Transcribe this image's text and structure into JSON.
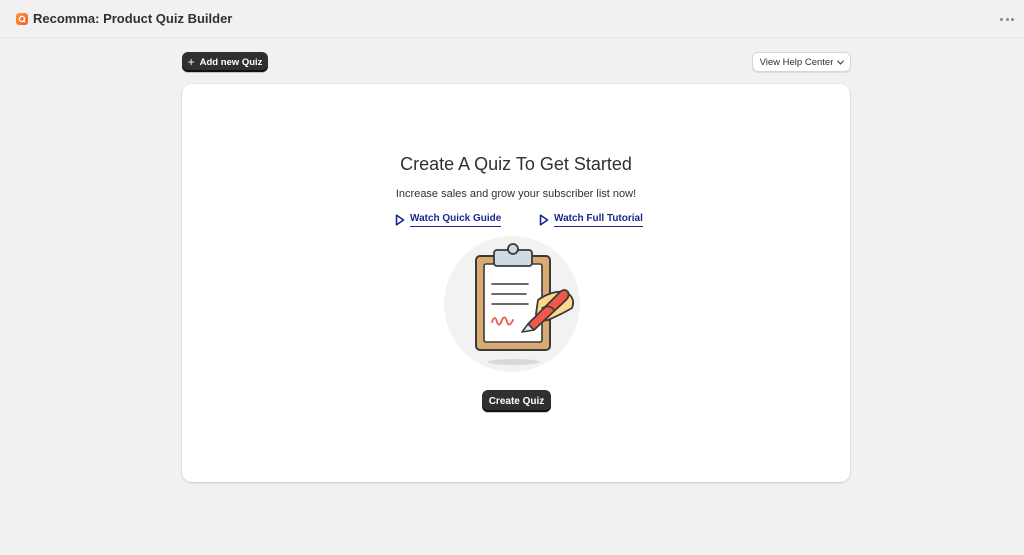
{
  "app": {
    "title": "Recomma: Product Quiz Builder",
    "logo_icon": "recomma-logo-icon",
    "accent": "#f25c2a"
  },
  "toolbar": {
    "add_quiz_label": "Add new Quiz",
    "help_label": "View Help Center"
  },
  "empty_state": {
    "title": "Create A Quiz To Get Started",
    "subtitle": "Increase sales and grow your subscriber list now!",
    "links": [
      {
        "label": "Watch Quick Guide",
        "icon": "play-icon"
      },
      {
        "label": "Watch Full Tutorial",
        "icon": "play-icon"
      }
    ],
    "illustration_icon": "clipboard-signing-illustration",
    "create_label": "Create Quiz"
  },
  "colors": {
    "background": "#f1f1f1",
    "button_dark": "#303030",
    "link": "#1a2a8c"
  }
}
